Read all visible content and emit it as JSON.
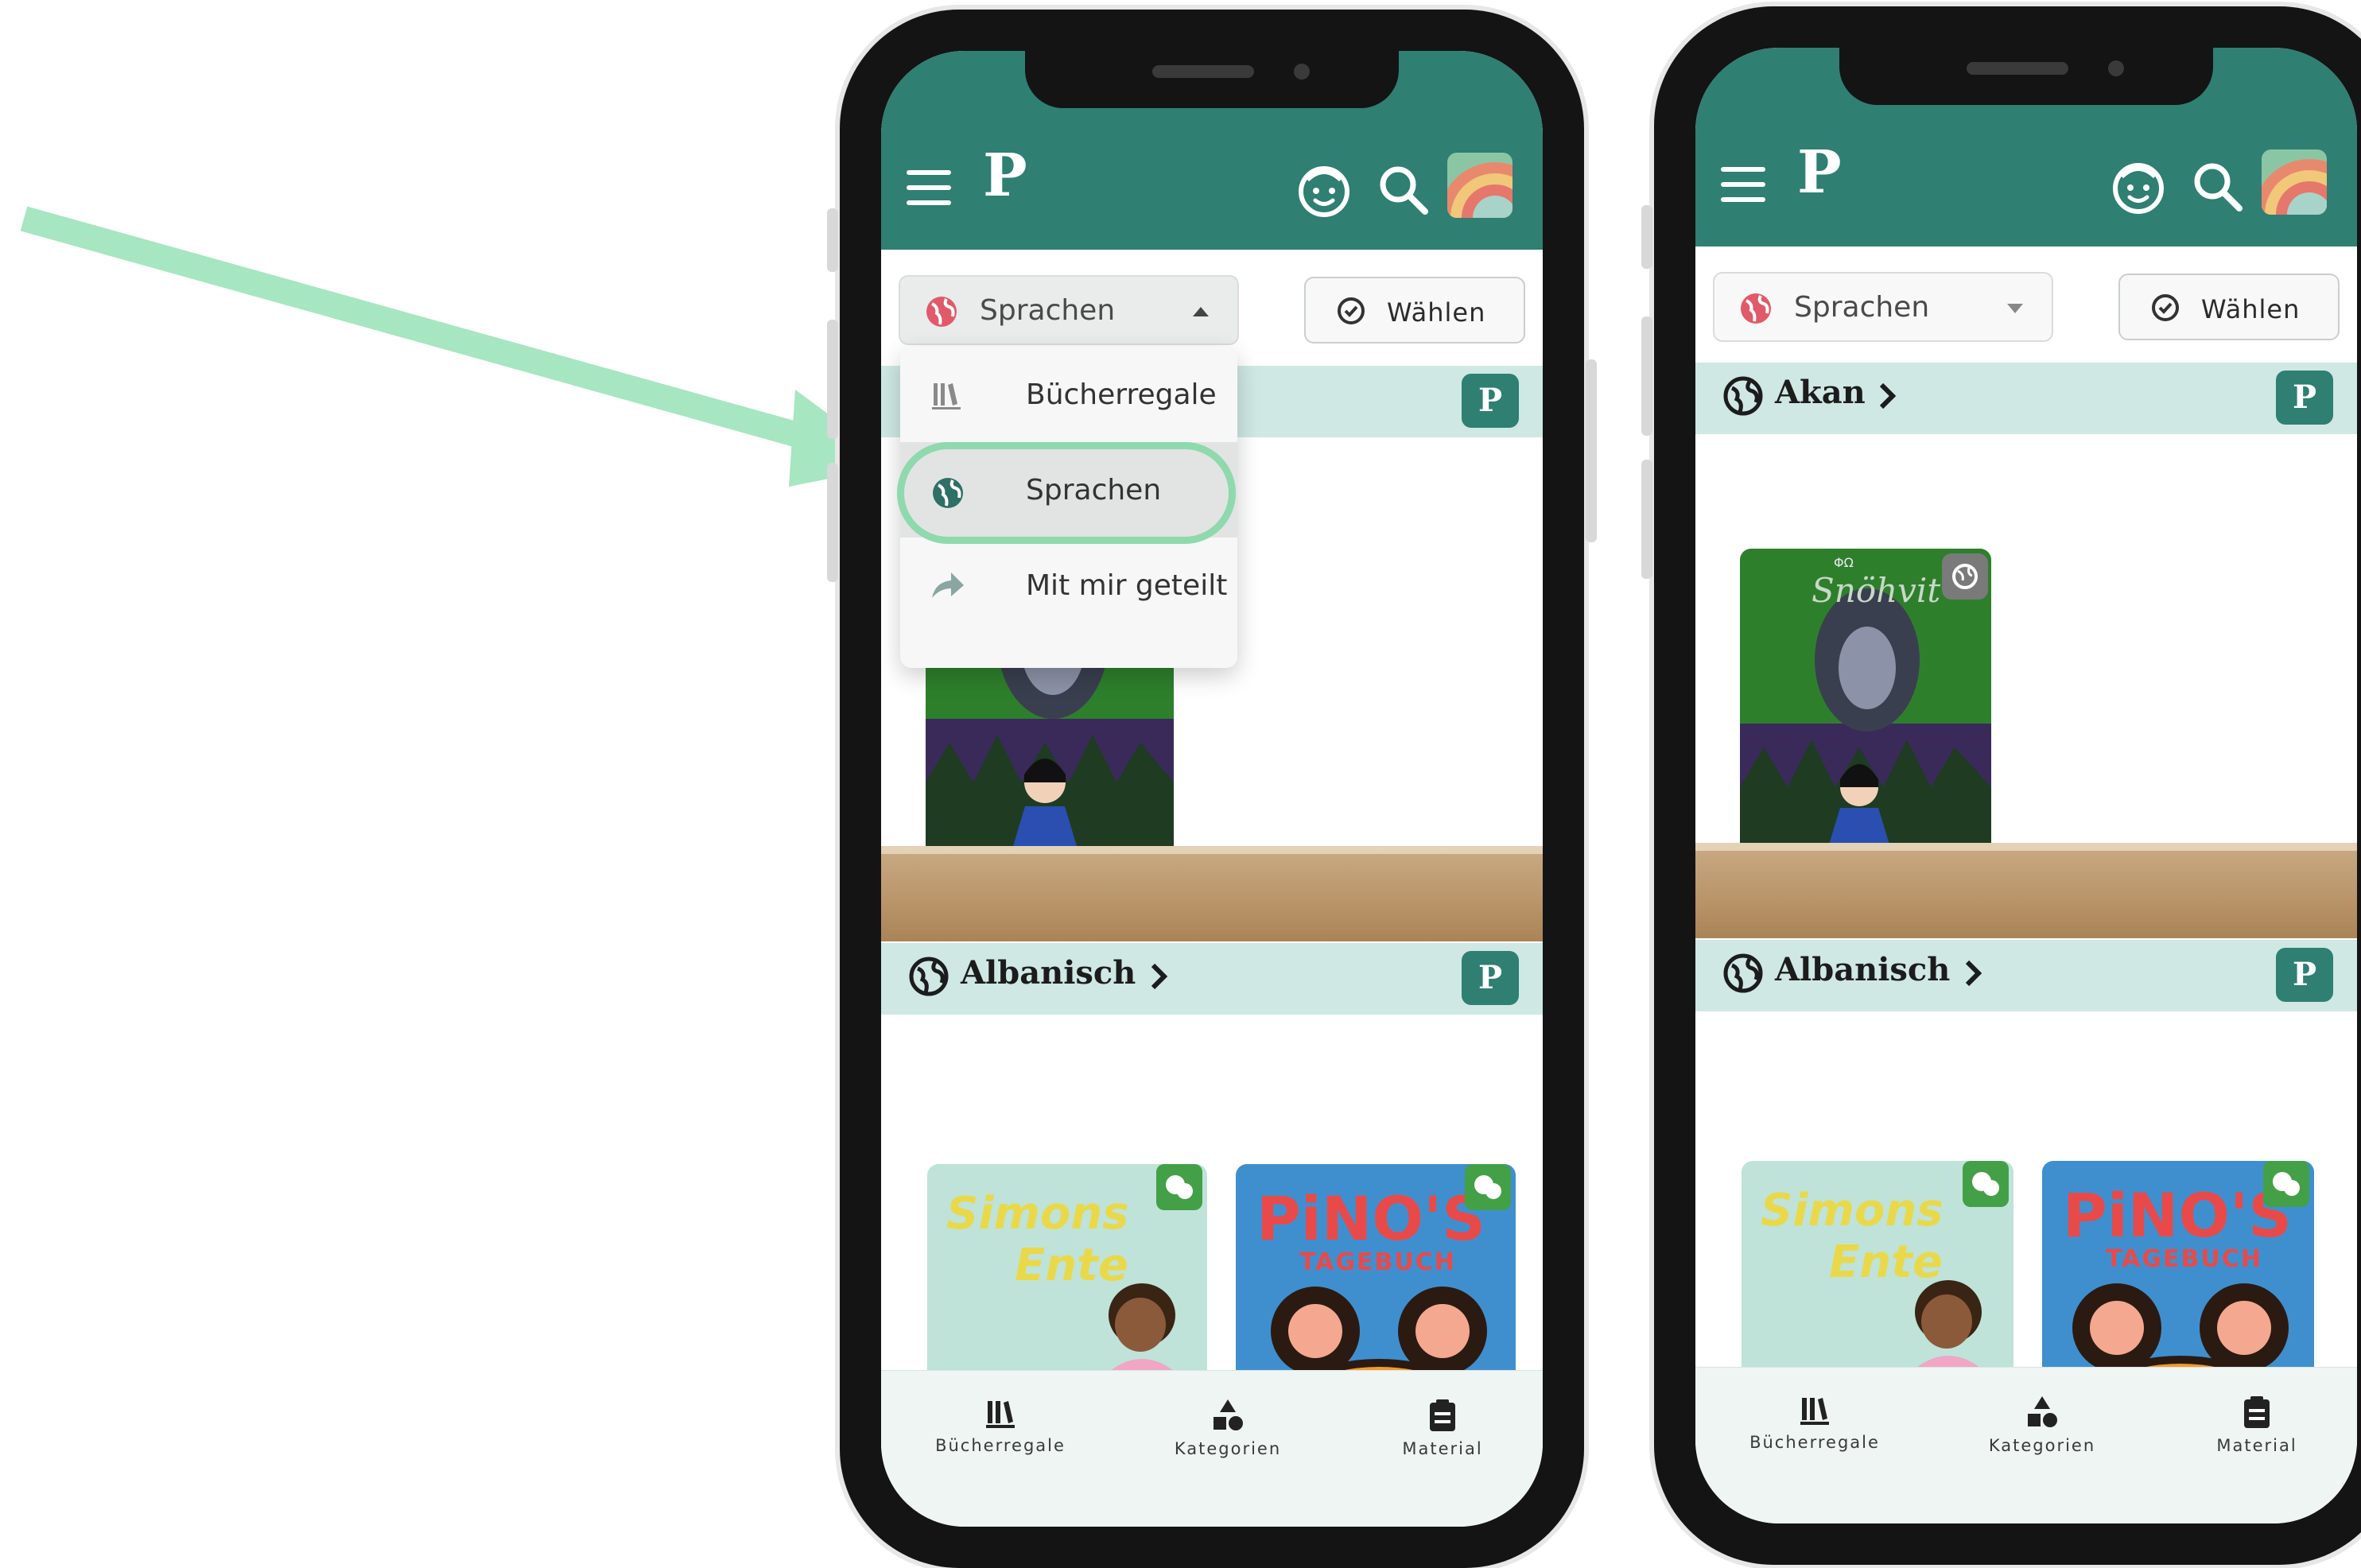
{
  "annotation": {
    "arrow_color": "#a6e6c1",
    "highlight_color": "#8ed9ad"
  },
  "colors": {
    "primary": "#2f7f73",
    "section_bg": "#cfe8e4",
    "badge_green": "#43a047"
  },
  "phones": [
    {
      "appbar": {
        "logo": "P",
        "icons": [
          "menu-icon",
          "child-face-icon",
          "search-icon",
          "avatar"
        ]
      },
      "toolbar": {
        "select_label": "Sprachen",
        "select_state": "open",
        "choose_label": "Wählen"
      },
      "dropdown": {
        "items": [
          {
            "label": "Bücherregale",
            "icon": "bookshelf-icon"
          },
          {
            "label": "Sprachen",
            "icon": "globe-icon",
            "active": true
          },
          {
            "label": "Mit mir geteilt",
            "icon": "share-arrow-icon"
          }
        ]
      },
      "sections": [
        {
          "title": "",
          "badge": "P"
        },
        {
          "title": "Albanisch",
          "badge": "P"
        }
      ],
      "bottom_nav": [
        "Bücherregale",
        "Kategorien",
        "Material"
      ]
    },
    {
      "appbar": {
        "logo": "P",
        "icons": [
          "menu-icon",
          "child-face-icon",
          "search-icon",
          "avatar"
        ]
      },
      "toolbar": {
        "select_label": "Sprachen",
        "select_state": "closed",
        "choose_label": "Wählen"
      },
      "sections": [
        {
          "title": "Akan",
          "badge": "P"
        },
        {
          "title": "Albanisch",
          "badge": "P"
        }
      ],
      "books": [
        {
          "title": "Snöhvit",
          "publisher": "ΦΩ"
        }
      ],
      "bottom_nav": [
        "Bücherregale",
        "Kategorien",
        "Material"
      ]
    }
  ],
  "covers": [
    {
      "title_line1": "Simons",
      "title_line2": "Ente"
    },
    {
      "title": "PiNO'S",
      "subtitle": "TAGEBUCH"
    }
  ]
}
